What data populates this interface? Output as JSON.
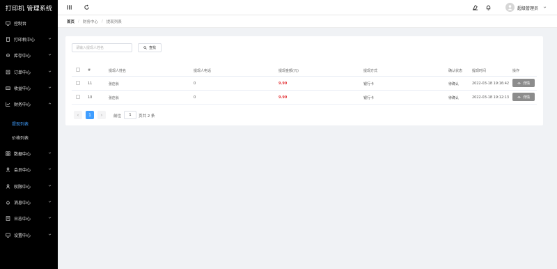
{
  "app": {
    "brand": "打印机 管理系统"
  },
  "sidebar": {
    "items": [
      {
        "label": "控制台",
        "icon": "monitor-icon"
      },
      {
        "label": "打印机中心",
        "icon": "document-icon"
      },
      {
        "label": "库存中心",
        "icon": "gear-icon"
      },
      {
        "label": "订单中心",
        "icon": "order-icon"
      },
      {
        "label": "收益中心",
        "icon": "wallet-icon"
      },
      {
        "label": "财务中心",
        "icon": "trend-icon"
      }
    ],
    "sub_items": [
      {
        "label": "提现列表"
      },
      {
        "label": "价格列表"
      }
    ],
    "items_bottom": [
      {
        "label": "数据中心",
        "icon": "grid-icon"
      },
      {
        "label": "会员中心",
        "icon": "user-icon"
      },
      {
        "label": "权限中心",
        "icon": "user-icon"
      },
      {
        "label": "消息中心",
        "icon": "bell-icon"
      },
      {
        "label": "日志中心",
        "icon": "log-icon"
      },
      {
        "label": "设置中心",
        "icon": "monitor-icon"
      }
    ]
  },
  "header": {
    "user_name": "超级管理员"
  },
  "breadcrumb": [
    "首页",
    "财务中心",
    "提现列表"
  ],
  "search": {
    "placeholder": "请输入提现人姓名",
    "button_label": "查找"
  },
  "table": {
    "columns": [
      "#",
      "提现人姓名",
      "提现人电话",
      "提现金额(元)",
      "提现方式",
      "确认状态",
      "提现时间",
      "操作"
    ],
    "rows": [
      {
        "id": "11",
        "name": "张店长",
        "phone": "0",
        "amount": "9.99",
        "method": "银行卡",
        "status": "待确认",
        "time": "2022-03-18 19:16:42",
        "action": "详情"
      },
      {
        "id": "10",
        "name": "张店长",
        "phone": "0",
        "amount": "9.99",
        "method": "银行卡",
        "status": "待确认",
        "time": "2022-03-18 19:12:13",
        "action": "详情"
      }
    ]
  },
  "pagination": {
    "prev": "‹",
    "current": "1",
    "next": "›",
    "goto_label": "前往",
    "goto_value": "1",
    "total_label": "页共 2 条"
  }
}
